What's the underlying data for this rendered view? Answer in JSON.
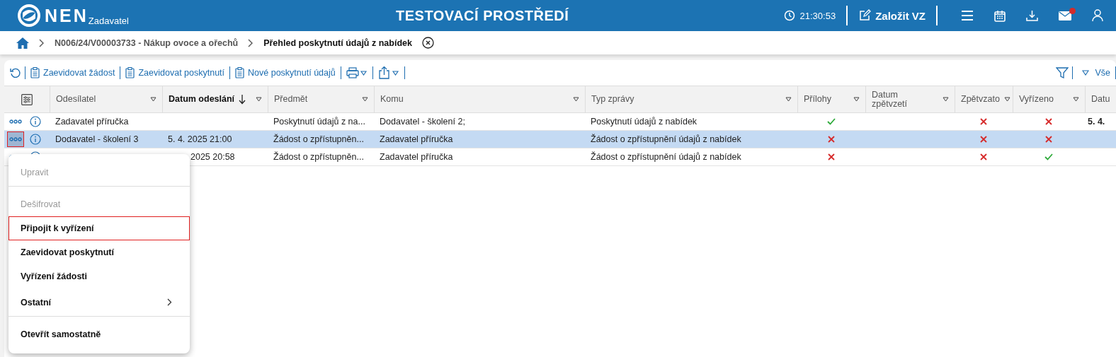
{
  "header": {
    "logo": "NEN",
    "subtitle": "Zadavatel",
    "title": "TESTOVACÍ PROSTŘEDÍ",
    "clock": "21:30:53",
    "create_button": "Založit VZ",
    "mail_unread": true
  },
  "breadcrumbs": [
    {
      "label": "N006/24/V00003733 - Nákup ovoce a ořechů",
      "current": false
    },
    {
      "label": "Přehled poskytnutí údajů z nabídek",
      "current": true
    }
  ],
  "toolbar": {
    "buttons": [
      "Zaevidovat žádost",
      "Zaevidovat poskytnutí",
      "Nové poskytnutí údajů"
    ],
    "filter_label": "Vše"
  },
  "table": {
    "columns": [
      {
        "label": "Odesílatel",
        "sorted": false
      },
      {
        "label": "Datum odeslání",
        "sorted": true
      },
      {
        "label": "Předmět",
        "sorted": false
      },
      {
        "label": "Komu",
        "sorted": false
      },
      {
        "label": "Typ zprávy",
        "sorted": false
      },
      {
        "label": "Přílohy",
        "sorted": false
      },
      {
        "label": "Datum zpětvzetí",
        "sorted": false
      },
      {
        "label": "Zpětvzato",
        "sorted": false
      },
      {
        "label": "Vyřízeno",
        "sorted": false
      },
      {
        "label": "Datu",
        "sorted": false
      }
    ],
    "rows": [
      {
        "selected": false,
        "focused": false,
        "sender": "Zadavatel příručka",
        "subject": "Poskytnutí údajů z na...",
        "recipient": "Dodavatel - školení 2;",
        "type": "Poskytnutí údajů z nabídek",
        "attachments": true,
        "withdrawn": false,
        "resolved": false,
        "column_10": "5. 4."
      },
      {
        "selected": true,
        "focused": true,
        "sender": "Dodavatel - školení 3",
        "sent": "5. 4. 2025 21:00",
        "subject": "Žádost o zpřístupněn...",
        "recipient": "Zadavatel příručka",
        "type": "Žádost o zpřístupnění údajů z nabídek",
        "attachments": false,
        "withdrawn": false,
        "resolved": false
      },
      {
        "selected": false,
        "focused": false,
        "sent": "2025 20:58",
        "subject": "Žádost o zpřístupněn...",
        "recipient": "Zadavatel příručka",
        "type": "Žádost o zpřístupnění údajů z nabídek",
        "attachments": false,
        "withdrawn": false,
        "resolved": true
      }
    ]
  },
  "context_menu": {
    "items": [
      {
        "label": "Upravit",
        "disabled": true,
        "focused": false,
        "submenu": false,
        "separator_after": true
      },
      {
        "label": "Dešifrovat",
        "disabled": true,
        "focused": false,
        "submenu": false,
        "separator_after": false
      },
      {
        "label": "Připojit k vyřízení",
        "disabled": false,
        "focused": true,
        "submenu": false,
        "separator_after": false
      },
      {
        "label": "Zaevidovat poskytnutí",
        "disabled": false,
        "focused": false,
        "submenu": false,
        "separator_after": false
      },
      {
        "label": "Vyřízení žádosti",
        "disabled": false,
        "focused": false,
        "submenu": false,
        "separator_after": false
      },
      {
        "label": "Ostatní",
        "disabled": false,
        "focused": false,
        "submenu": true,
        "separator_after": true
      },
      {
        "label": "Otevřít samostatně",
        "disabled": false,
        "focused": false,
        "submenu": false,
        "separator_after": false
      }
    ]
  }
}
